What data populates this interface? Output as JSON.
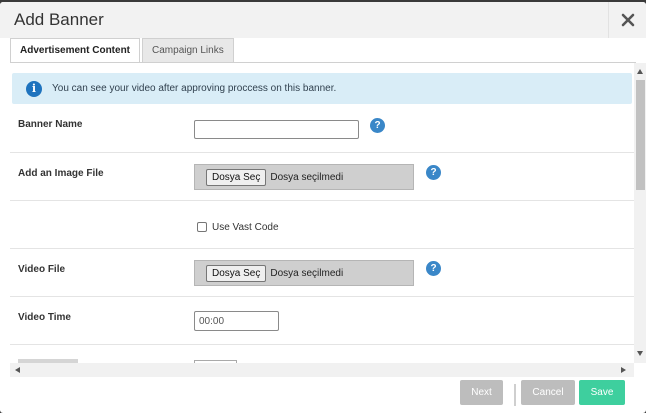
{
  "modal": {
    "title": "Add Banner",
    "close_icon": "close-icon"
  },
  "tabs": [
    {
      "label": "Advertisement Content",
      "active": true
    },
    {
      "label": "Campaign Links",
      "active": false
    }
  ],
  "alert": {
    "icon": "info-icon",
    "text": "You can see your video after approving proccess on this banner."
  },
  "form": {
    "banner_name": {
      "label": "Banner Name",
      "value": "",
      "placeholder": ""
    },
    "image_file": {
      "label": "Add an Image File",
      "button": "Dosya Seç",
      "status": "Dosya seçilmedi"
    },
    "vast": {
      "label": "Use Vast Code",
      "checked": false
    },
    "video_file": {
      "label": "Video File",
      "button": "Dosya Seç",
      "status": "Dosya seçilmedi"
    },
    "video_time": {
      "label": "Video Time",
      "placeholder": "00:00"
    },
    "help_icon": "?"
  },
  "footer": {
    "next_label": "Next",
    "cancel_label": "Cancel",
    "save_label": "Save"
  },
  "colors": {
    "save": "#3ecf9e",
    "disabled": "#bdbdbd",
    "alert_bg": "#d9edf7",
    "help": "#3a87c8"
  }
}
